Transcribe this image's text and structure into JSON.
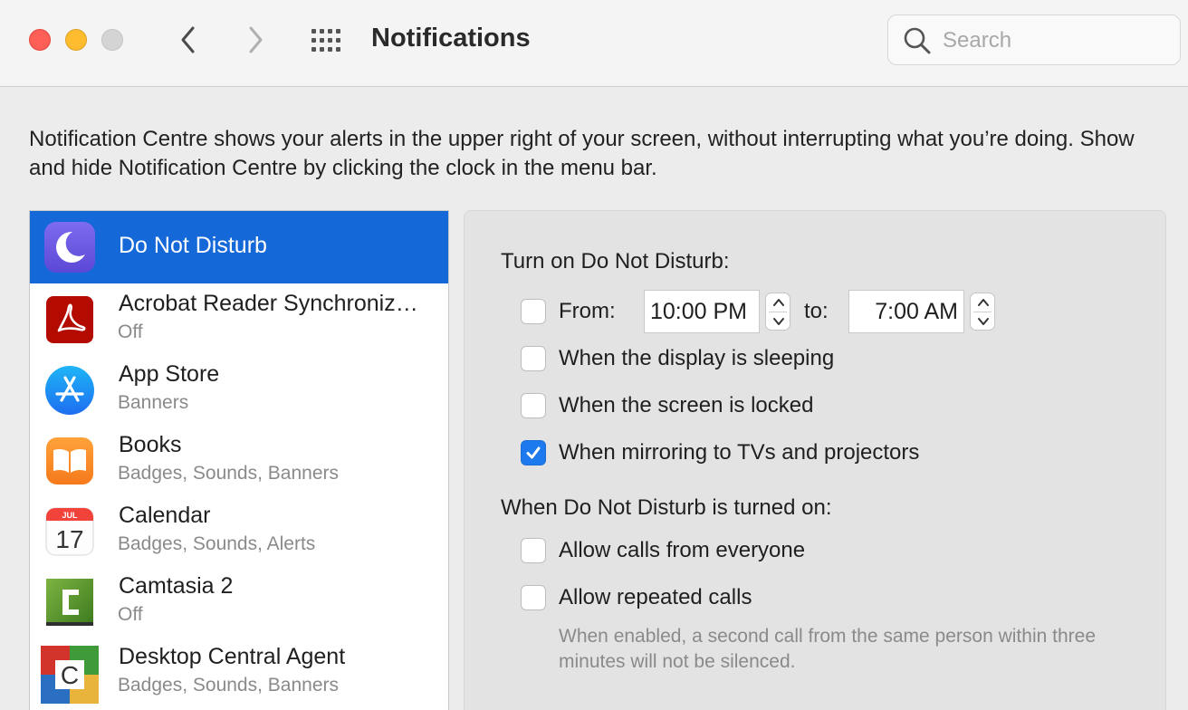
{
  "window": {
    "title": "Notifications",
    "search_placeholder": "Search"
  },
  "description": "Notification Centre shows your alerts in the upper right of your screen, without interrupting what you’re doing. Show and hide Notification Centre by clicking the clock in the menu bar.",
  "apps": [
    {
      "name": "Do Not Disturb",
      "subtitle": "",
      "icon": "moon-icon",
      "selected": true
    },
    {
      "name": "Acrobat Reader Synchroniz…",
      "subtitle": "Off",
      "icon": "acrobat-icon"
    },
    {
      "name": "App Store",
      "subtitle": "Banners",
      "icon": "app-store-icon"
    },
    {
      "name": "Books",
      "subtitle": "Badges, Sounds, Banners",
      "icon": "books-icon"
    },
    {
      "name": "Calendar",
      "subtitle": "Badges, Sounds, Alerts",
      "icon": "calendar-icon",
      "calendar_month": "JUL",
      "calendar_day": "17"
    },
    {
      "name": "Camtasia 2",
      "subtitle": "Off",
      "icon": "camtasia-icon"
    },
    {
      "name": "Desktop Central Agent",
      "subtitle": "Badges, Sounds, Banners",
      "icon": "desktop-central-icon",
      "icon_letter": "C"
    }
  ],
  "dnd": {
    "turn_on_label": "Turn on Do Not Disturb:",
    "from_label": "From:",
    "from_time": "10:00 PM",
    "to_label": "to:",
    "to_time": "7:00 AM",
    "from_checked": false,
    "display_sleeping_label": "When the display is sleeping",
    "display_sleeping_checked": false,
    "screen_locked_label": "When the screen is locked",
    "screen_locked_checked": false,
    "mirroring_label": "When mirroring to TVs and projectors",
    "mirroring_checked": true,
    "when_on_label": "When Do Not Disturb is turned on:",
    "allow_calls_label": "Allow calls from everyone",
    "allow_calls_checked": false,
    "repeated_calls_label": "Allow repeated calls",
    "repeated_calls_checked": false,
    "repeated_calls_note": "When enabled, a second call from the same person within three minutes will not be silenced."
  },
  "colors": {
    "selection": "#1468d8",
    "checkbox_checked": "#1c7aee",
    "close": "#fe5f57",
    "minimize": "#febc2e"
  }
}
